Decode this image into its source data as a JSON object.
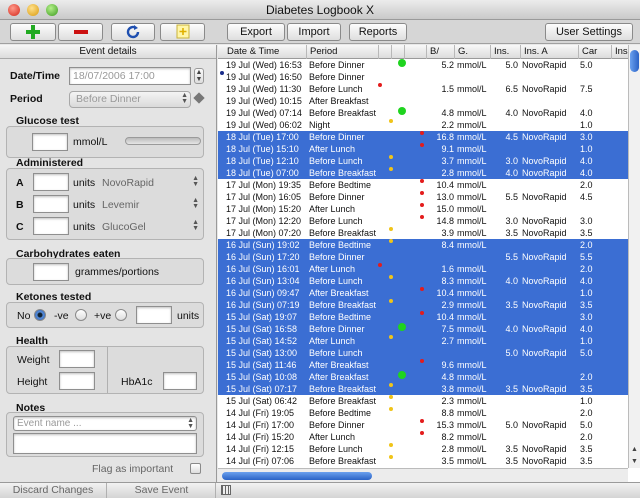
{
  "window": {
    "title": "Diabetes Logbook X"
  },
  "toolbar": {
    "export_label": "Export",
    "import_label": "Import",
    "reports_label": "Reports",
    "user_settings_label": "User Settings"
  },
  "event_details": {
    "header": "Event details",
    "datetime_label": "Date/Time",
    "datetime_value": "18/07/2006 17:00",
    "period_label": "Period",
    "period_value": "Before Dinner",
    "glucose": {
      "title": "Glucose test",
      "unit": "mmol/L"
    },
    "administered": {
      "title": "Administered",
      "rows": [
        {
          "letter": "A",
          "units": "units",
          "insulin": "NovoRapid"
        },
        {
          "letter": "B",
          "units": "units",
          "insulin": "Levemir"
        },
        {
          "letter": "C",
          "units": "units",
          "insulin": "GlucoGel"
        }
      ]
    },
    "carbs": {
      "title": "Carbohydrates eaten",
      "unit": "grammes/portions"
    },
    "ketones": {
      "title": "Ketones tested",
      "no_label": "No",
      "neg_label": "-ve",
      "pos_label": "+ve",
      "units_label": "units"
    },
    "health": {
      "title": "Health",
      "weight_label": "Weight",
      "height_label": "Height",
      "hba1c_label": "HbA1c"
    },
    "notes": {
      "title": "Notes",
      "placeholder": "Event name ..."
    },
    "flag_label": "Flag as important"
  },
  "bottom": {
    "discard_label": "Discard Changes",
    "save_label": "Save Event"
  },
  "log": {
    "columns": [
      "Date & Time",
      "Period",
      "",
      "",
      "",
      "B/",
      "G.",
      "Ins.",
      "Ins. A",
      "Car",
      "Ins."
    ],
    "rows": [
      {
        "date": "19 Jul (Wed) 16:53",
        "period": "Before Dinner",
        "marker": "green",
        "g": "5.2",
        "unit": "mmol/L",
        "ins": "5.0",
        "insA": "NovoRapid",
        "car": "5.0",
        "sel": false
      },
      {
        "date": "19 Jul (Wed) 16:50",
        "period": "Before Dinner",
        "marker": "",
        "g": "",
        "unit": "",
        "ins": "",
        "insA": "",
        "car": "",
        "sel": false,
        "bullet": true
      },
      {
        "date": "19 Jul (Wed) 11:30",
        "period": "Before Lunch",
        "marker": "red-left",
        "g": "1.5",
        "unit": "mmol/L",
        "ins": "6.5",
        "insA": "NovoRapid",
        "car": "7.5",
        "sel": false
      },
      {
        "date": "19 Jul (Wed) 10:15",
        "period": "After Breakfast",
        "marker": "",
        "g": "",
        "unit": "",
        "ins": "",
        "insA": "",
        "car": "",
        "sel": false
      },
      {
        "date": "19 Jul (Wed) 07:14",
        "period": "Before Breakfast",
        "marker": "green",
        "g": "4.8",
        "unit": "mmol/L",
        "ins": "4.0",
        "insA": "NovoRapid",
        "car": "4.0",
        "sel": false
      },
      {
        "date": "19 Jul (Wed) 06:02",
        "period": "Night",
        "marker": "yellow",
        "g": "2.2",
        "unit": "mmol/L",
        "ins": "",
        "insA": "",
        "car": "1.0",
        "sel": false
      },
      {
        "date": "18 Jul (Tue) 17:00",
        "period": "Before Dinner",
        "marker": "red",
        "g": "16.8",
        "unit": "mmol/L",
        "ins": "4.5",
        "insA": "NovoRapid",
        "car": "3.0",
        "sel": true
      },
      {
        "date": "18 Jul (Tue) 15:10",
        "period": "After Lunch",
        "marker": "red",
        "g": "9.1",
        "unit": "mmol/L",
        "ins": "",
        "insA": "",
        "car": "1.0",
        "sel": true
      },
      {
        "date": "18 Jul (Tue) 12:10",
        "period": "Before Lunch",
        "marker": "yellow",
        "g": "3.7",
        "unit": "mmol/L",
        "ins": "3.0",
        "insA": "NovoRapid",
        "car": "4.0",
        "sel": true
      },
      {
        "date": "18 Jul (Tue) 07:00",
        "period": "Before Breakfast",
        "marker": "yellow",
        "g": "2.8",
        "unit": "mmol/L",
        "ins": "4.0",
        "insA": "NovoRapid",
        "car": "4.0",
        "sel": true
      },
      {
        "date": "17 Jul (Mon) 19:35",
        "period": "Before Bedtime",
        "marker": "red",
        "g": "10.4",
        "unit": "mmol/L",
        "ins": "",
        "insA": "",
        "car": "2.0",
        "sel": false
      },
      {
        "date": "17 Jul (Mon) 16:05",
        "period": "Before Dinner",
        "marker": "red",
        "g": "13.0",
        "unit": "mmol/L",
        "ins": "5.5",
        "insA": "NovoRapid",
        "car": "4.5",
        "sel": false
      },
      {
        "date": "17 Jul (Mon) 15:20",
        "period": "After Lunch",
        "marker": "red",
        "g": "15.0",
        "unit": "mmol/L",
        "ins": "",
        "insA": "",
        "car": "",
        "sel": false
      },
      {
        "date": "17 Jul (Mon) 12:20",
        "period": "Before Lunch",
        "marker": "red",
        "g": "14.8",
        "unit": "mmol/L",
        "ins": "3.0",
        "insA": "NovoRapid",
        "car": "3.0",
        "sel": false
      },
      {
        "date": "17 Jul (Mon) 07:20",
        "period": "Before Breakfast",
        "marker": "yellow",
        "g": "3.9",
        "unit": "mmol/L",
        "ins": "3.5",
        "insA": "NovoRapid",
        "car": "3.5",
        "sel": false
      },
      {
        "date": "16 Jul (Sun) 19:02",
        "period": "Before Bedtime",
        "marker": "yellow",
        "g": "8.4",
        "unit": "mmol/L",
        "ins": "",
        "insA": "",
        "car": "2.0",
        "sel": true
      },
      {
        "date": "16 Jul (Sun) 17:20",
        "period": "Before Dinner",
        "marker": "",
        "g": "",
        "unit": "",
        "ins": "5.5",
        "insA": "NovoRapid",
        "car": "5.5",
        "sel": true
      },
      {
        "date": "16 Jul (Sun) 16:01",
        "period": "After Lunch",
        "marker": "red-left",
        "g": "1.6",
        "unit": "mmol/L",
        "ins": "",
        "insA": "",
        "car": "2.0",
        "sel": true
      },
      {
        "date": "16 Jul (Sun) 13:04",
        "period": "Before Lunch",
        "marker": "yellow",
        "g": "8.3",
        "unit": "mmol/L",
        "ins": "4.0",
        "insA": "NovoRapid",
        "car": "4.0",
        "sel": true
      },
      {
        "date": "16 Jul (Sun) 09:47",
        "period": "After Breakfast",
        "marker": "red",
        "g": "10.4",
        "unit": "mmol/L",
        "ins": "",
        "insA": "",
        "car": "1.0",
        "sel": true
      },
      {
        "date": "16 Jul (Sun) 07:19",
        "period": "Before Breakfast",
        "marker": "yellow",
        "g": "2.9",
        "unit": "mmol/L",
        "ins": "3.5",
        "insA": "NovoRapid",
        "car": "3.5",
        "sel": true
      },
      {
        "date": "15 Jul (Sat) 19:07",
        "period": "Before Bedtime",
        "marker": "red",
        "g": "10.4",
        "unit": "mmol/L",
        "ins": "",
        "insA": "",
        "car": "3.0",
        "sel": true
      },
      {
        "date": "15 Jul (Sat) 16:58",
        "period": "Before Dinner",
        "marker": "green",
        "g": "7.5",
        "unit": "mmol/L",
        "ins": "4.0",
        "insA": "NovoRapid",
        "car": "4.0",
        "sel": true
      },
      {
        "date": "15 Jul (Sat) 14:52",
        "period": "After Lunch",
        "marker": "yellow",
        "g": "2.7",
        "unit": "mmol/L",
        "ins": "",
        "insA": "",
        "car": "1.0",
        "sel": true
      },
      {
        "date": "15 Jul (Sat) 13:00",
        "period": "Before Lunch",
        "marker": "",
        "g": "",
        "unit": "",
        "ins": "5.0",
        "insA": "NovoRapid",
        "car": "5.0",
        "sel": true
      },
      {
        "date": "15 Jul (Sat) 11:46",
        "period": "After Breakfast",
        "marker": "red",
        "g": "9.6",
        "unit": "mmol/L",
        "ins": "",
        "insA": "",
        "car": "",
        "sel": true
      },
      {
        "date": "15 Jul (Sat) 10:08",
        "period": "After Breakfast",
        "marker": "green",
        "g": "4.8",
        "unit": "mmol/L",
        "ins": "",
        "insA": "",
        "car": "2.0",
        "sel": true
      },
      {
        "date": "15 Jul (Sat) 07:17",
        "period": "Before Breakfast",
        "marker": "yellow",
        "g": "3.8",
        "unit": "mmol/L",
        "ins": "3.5",
        "insA": "NovoRapid",
        "car": "3.5",
        "sel": true
      },
      {
        "date": "15 Jul (Sat) 06:42",
        "period": "Before Breakfast",
        "marker": "yellow",
        "g": "2.3",
        "unit": "mmol/L",
        "ins": "",
        "insA": "",
        "car": "1.0",
        "sel": false
      },
      {
        "date": "14 Jul (Fri) 19:05",
        "period": "Before Bedtime",
        "marker": "yellow",
        "g": "8.8",
        "unit": "mmol/L",
        "ins": "",
        "insA": "",
        "car": "2.0",
        "sel": false
      },
      {
        "date": "14 Jul (Fri) 17:00",
        "period": "Before Dinner",
        "marker": "red",
        "g": "15.3",
        "unit": "mmol/L",
        "ins": "5.0",
        "insA": "NovoRapid",
        "car": "5.0",
        "sel": false
      },
      {
        "date": "14 Jul (Fri) 15:20",
        "period": "After Lunch",
        "marker": "red",
        "g": "8.2",
        "unit": "mmol/L",
        "ins": "",
        "insA": "",
        "car": "2.0",
        "sel": false
      },
      {
        "date": "14 Jul (Fri) 12:15",
        "period": "Before Lunch",
        "marker": "yellow",
        "g": "2.8",
        "unit": "mmol/L",
        "ins": "3.5",
        "insA": "NovoRapid",
        "car": "3.5",
        "sel": false
      },
      {
        "date": "14 Jul (Fri) 07:06",
        "period": "Before Breakfast",
        "marker": "yellow",
        "g": "3.5",
        "unit": "mmol/L",
        "ins": "3.5",
        "insA": "NovoRapid",
        "car": "3.5",
        "sel": false
      }
    ]
  },
  "colors": {
    "selection": "#3b6ed3",
    "add_icon": "#22aa22",
    "remove_icon": "#cc1111",
    "refresh_icon": "#1f4fb0"
  }
}
